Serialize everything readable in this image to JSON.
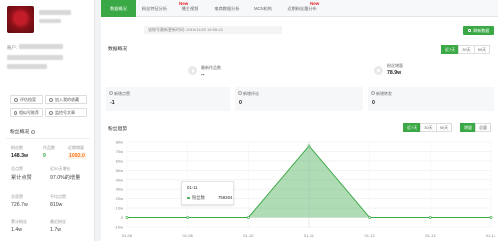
{
  "sidebar": {
    "account_label": "账户:",
    "actions": {
      "edit_label": "评估档案",
      "add_label": "加入我的收藏",
      "compare_label": "相似号推荐",
      "monitor_label": "监控号文章"
    },
    "overview_title": "粉丝概况",
    "stats": [
      {
        "label": "粉丝数",
        "value": "148.3w"
      },
      {
        "label": "作品数",
        "value": "9"
      },
      {
        "label": "近期增量",
        "value": "1092.0"
      },
      {
        "label": "总点赞",
        "value": "累计点赞"
      },
      {
        "label": "近30天增长",
        "value": "97.0%的增量"
      },
      {
        "label": "总获赞",
        "value": "726.7w"
      },
      {
        "label": "平均点赞",
        "value": "810w"
      },
      {
        "label": "累计粉丝",
        "value": "1.4w"
      },
      {
        "label": "最近粉丝",
        "value": "1.7w"
      }
    ]
  },
  "tabs": [
    {
      "label": "数据概况",
      "active": true,
      "badge": ""
    },
    {
      "label": "粉丝特征分析",
      "active": false,
      "badge": "New"
    },
    {
      "label": "播主视频",
      "active": false,
      "badge": ""
    },
    {
      "label": "电商数据分析",
      "active": false,
      "badge": ""
    },
    {
      "label": "MCN机构",
      "active": false,
      "badge": ""
    },
    {
      "label": "近期粉丝量分布",
      "active": false,
      "badge": "New"
    }
  ],
  "update_text": "该账号最新更新时间: 2019/11/20 19:55:13",
  "refresh_label": "刷新数据",
  "overview": {
    "title": "数据概况",
    "ranges": [
      "近7天",
      "30天",
      "90天"
    ],
    "active_range": "近7天",
    "kpis": [
      {
        "label": "最新作品数",
        "value": "--",
        "icon": "play-icon"
      },
      {
        "label": "粉丝增量",
        "value": "78.9w",
        "icon": "fans-icon"
      }
    ],
    "cards": [
      {
        "label": "新增点赞",
        "value": "-1",
        "icon": "like-icon"
      },
      {
        "label": "新增评论",
        "value": "0",
        "icon": "comment-icon"
      },
      {
        "label": "新增转发",
        "value": "0",
        "icon": "share-icon"
      }
    ]
  },
  "trend": {
    "title": "粉丝趋势",
    "ranges": [
      "近7天",
      "30天",
      "90天"
    ],
    "active_range": "近7天",
    "modes": [
      "增量",
      "总量"
    ],
    "active_mode": "增量",
    "tooltip": {
      "date": "01-11",
      "series": "粉丝数",
      "value": "759284"
    }
  },
  "chart_data": {
    "type": "area",
    "categories": [
      "01-06",
      "01-08",
      "01-10",
      "01-11",
      "01-12",
      "01-13",
      "01-14"
    ],
    "series": [
      {
        "name": "粉丝数",
        "values": [
          0,
          0,
          0,
          759284,
          0,
          0,
          0
        ]
      }
    ],
    "yticks": [
      "80w",
      "70w",
      "60w",
      "50w",
      "40w",
      "30w",
      "20w",
      "10w",
      "0",
      "-10w"
    ],
    "ylim": [
      -100000,
      800000
    ],
    "grid": true,
    "accent": "#3aa845"
  }
}
